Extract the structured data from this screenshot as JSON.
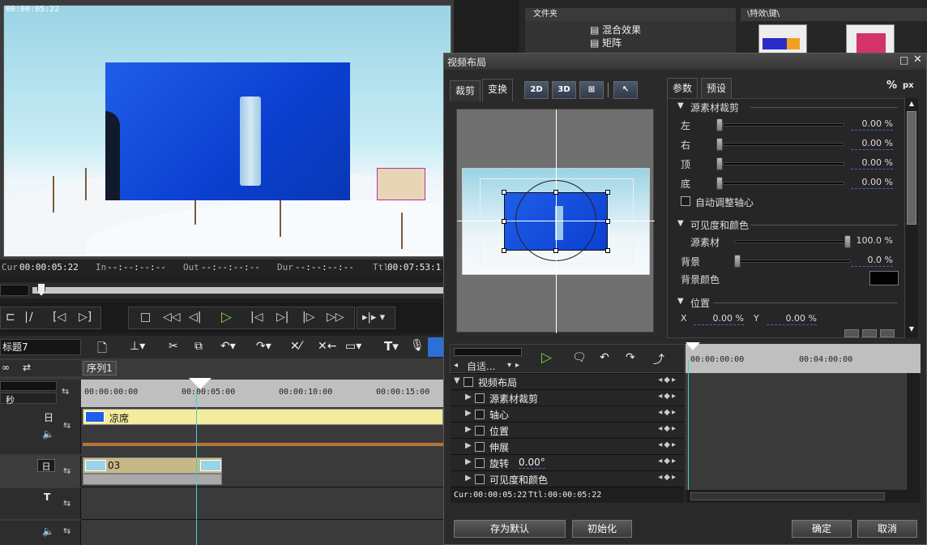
{
  "preview": {
    "overlay_timecode": "00:00:05:22",
    "cur_label": "Cur",
    "cur_value": "00:00:05:22",
    "in_label": "In",
    "in_value": "--:--:--:--",
    "out_label": "Out",
    "out_value": "--:--:--:--",
    "dur_label": "Dur",
    "dur_value": "--:--:--:--",
    "ttl_label": "Ttl",
    "ttl_value": "00:07:53:1"
  },
  "transport": {
    "icons": [
      "stop-icon",
      "rewind-icon",
      "step-back-icon",
      "play-icon",
      "prev-edit-icon",
      "next-edit-icon",
      "step-forward-icon",
      "fast-forward-icon"
    ],
    "glyphs": [
      "□",
      "◁◁",
      "◁|",
      "▷",
      "|◁",
      "▷|",
      "|▷",
      "▷▷"
    ]
  },
  "timeline": {
    "project_title": "标题7",
    "sequence_tab": "序列1",
    "unit_label": "秒",
    "ruler": [
      "00:00:00:00",
      "00:00:05:00",
      "00:00:10:00",
      "00:00:15:00"
    ],
    "clip_top_name": "凉席",
    "clip_bottom_name": "03"
  },
  "top_right": {
    "folder_header": "文件夹",
    "folder_items": [
      "混合效果",
      "矩阵"
    ],
    "effects_header": "\\特效\\键\\"
  },
  "dialog": {
    "title": "视频布局",
    "tab_crop": "裁剪",
    "tab_transform": "变换",
    "btn_2d": "2D",
    "btn_3d": "3D",
    "tab_params": "参数",
    "tab_preset": "预设",
    "unit_pct": "%",
    "unit_px": "px",
    "sections": {
      "source_crop": "源素材裁剪",
      "visibility": "可见度和颜色",
      "position": "位置"
    },
    "crop": [
      {
        "label": "左",
        "value": "0.00 %"
      },
      {
        "label": "右",
        "value": "0.00 %"
      },
      {
        "label": "顶",
        "value": "0.00 %"
      },
      {
        "label": "底",
        "value": "0.00 %"
      }
    ],
    "auto_pivot": "自动调整轴心",
    "source_label": "源素材",
    "source_value": "100.0 %",
    "bg_label": "背景",
    "bg_value": "0.0 %",
    "bg_color_label": "背景颜色",
    "bg_color": "#000000",
    "pos_x_label": "X",
    "pos_x_value": "0.00 %",
    "pos_y_label": "Y",
    "pos_y_value": "0.00 %",
    "fit_label": "自适...",
    "kf_ruler": [
      "00:00:00:00",
      "00:04:00:00"
    ],
    "kf_items": [
      "视频布局",
      "源素材裁剪",
      "轴心",
      "位置",
      "伸展",
      "旋转",
      "可见度和颜色"
    ],
    "rotate_value": "0.00°",
    "cur_label": "Cur:00:00:05:22",
    "ttl_label": "Ttl:00:00:05:22",
    "save_default": "存为默认",
    "initialize": "初始化",
    "ok": "确定",
    "cancel": "取消"
  },
  "colors": {
    "accent_blue": "#2c6fd6",
    "clip_yellow": "#f2ec9c",
    "clip_tan": "#c8b888",
    "play_green": "#7ecf3c"
  }
}
